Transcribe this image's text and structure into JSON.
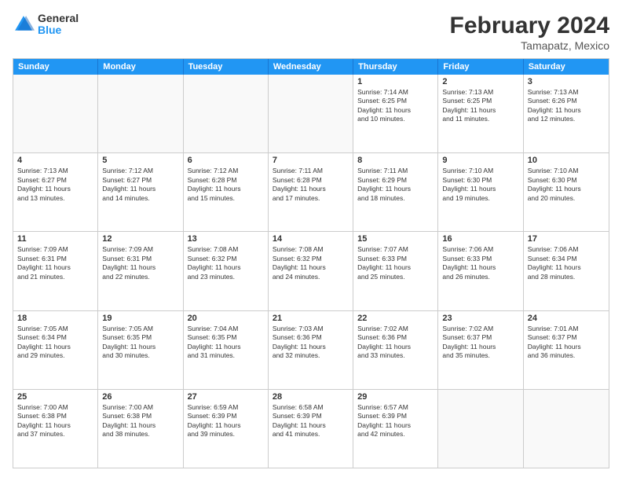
{
  "header": {
    "logo_general": "General",
    "logo_blue": "Blue",
    "month_title": "February 2024",
    "location": "Tamapatz, Mexico"
  },
  "days_of_week": [
    "Sunday",
    "Monday",
    "Tuesday",
    "Wednesday",
    "Thursday",
    "Friday",
    "Saturday"
  ],
  "rows": [
    [
      {
        "day": "",
        "text": ""
      },
      {
        "day": "",
        "text": ""
      },
      {
        "day": "",
        "text": ""
      },
      {
        "day": "",
        "text": ""
      },
      {
        "day": "1",
        "text": "Sunrise: 7:14 AM\nSunset: 6:25 PM\nDaylight: 11 hours\nand 10 minutes."
      },
      {
        "day": "2",
        "text": "Sunrise: 7:13 AM\nSunset: 6:25 PM\nDaylight: 11 hours\nand 11 minutes."
      },
      {
        "day": "3",
        "text": "Sunrise: 7:13 AM\nSunset: 6:26 PM\nDaylight: 11 hours\nand 12 minutes."
      }
    ],
    [
      {
        "day": "4",
        "text": "Sunrise: 7:13 AM\nSunset: 6:27 PM\nDaylight: 11 hours\nand 13 minutes."
      },
      {
        "day": "5",
        "text": "Sunrise: 7:12 AM\nSunset: 6:27 PM\nDaylight: 11 hours\nand 14 minutes."
      },
      {
        "day": "6",
        "text": "Sunrise: 7:12 AM\nSunset: 6:28 PM\nDaylight: 11 hours\nand 15 minutes."
      },
      {
        "day": "7",
        "text": "Sunrise: 7:11 AM\nSunset: 6:28 PM\nDaylight: 11 hours\nand 17 minutes."
      },
      {
        "day": "8",
        "text": "Sunrise: 7:11 AM\nSunset: 6:29 PM\nDaylight: 11 hours\nand 18 minutes."
      },
      {
        "day": "9",
        "text": "Sunrise: 7:10 AM\nSunset: 6:30 PM\nDaylight: 11 hours\nand 19 minutes."
      },
      {
        "day": "10",
        "text": "Sunrise: 7:10 AM\nSunset: 6:30 PM\nDaylight: 11 hours\nand 20 minutes."
      }
    ],
    [
      {
        "day": "11",
        "text": "Sunrise: 7:09 AM\nSunset: 6:31 PM\nDaylight: 11 hours\nand 21 minutes."
      },
      {
        "day": "12",
        "text": "Sunrise: 7:09 AM\nSunset: 6:31 PM\nDaylight: 11 hours\nand 22 minutes."
      },
      {
        "day": "13",
        "text": "Sunrise: 7:08 AM\nSunset: 6:32 PM\nDaylight: 11 hours\nand 23 minutes."
      },
      {
        "day": "14",
        "text": "Sunrise: 7:08 AM\nSunset: 6:32 PM\nDaylight: 11 hours\nand 24 minutes."
      },
      {
        "day": "15",
        "text": "Sunrise: 7:07 AM\nSunset: 6:33 PM\nDaylight: 11 hours\nand 25 minutes."
      },
      {
        "day": "16",
        "text": "Sunrise: 7:06 AM\nSunset: 6:33 PM\nDaylight: 11 hours\nand 26 minutes."
      },
      {
        "day": "17",
        "text": "Sunrise: 7:06 AM\nSunset: 6:34 PM\nDaylight: 11 hours\nand 28 minutes."
      }
    ],
    [
      {
        "day": "18",
        "text": "Sunrise: 7:05 AM\nSunset: 6:34 PM\nDaylight: 11 hours\nand 29 minutes."
      },
      {
        "day": "19",
        "text": "Sunrise: 7:05 AM\nSunset: 6:35 PM\nDaylight: 11 hours\nand 30 minutes."
      },
      {
        "day": "20",
        "text": "Sunrise: 7:04 AM\nSunset: 6:35 PM\nDaylight: 11 hours\nand 31 minutes."
      },
      {
        "day": "21",
        "text": "Sunrise: 7:03 AM\nSunset: 6:36 PM\nDaylight: 11 hours\nand 32 minutes."
      },
      {
        "day": "22",
        "text": "Sunrise: 7:02 AM\nSunset: 6:36 PM\nDaylight: 11 hours\nand 33 minutes."
      },
      {
        "day": "23",
        "text": "Sunrise: 7:02 AM\nSunset: 6:37 PM\nDaylight: 11 hours\nand 35 minutes."
      },
      {
        "day": "24",
        "text": "Sunrise: 7:01 AM\nSunset: 6:37 PM\nDaylight: 11 hours\nand 36 minutes."
      }
    ],
    [
      {
        "day": "25",
        "text": "Sunrise: 7:00 AM\nSunset: 6:38 PM\nDaylight: 11 hours\nand 37 minutes."
      },
      {
        "day": "26",
        "text": "Sunrise: 7:00 AM\nSunset: 6:38 PM\nDaylight: 11 hours\nand 38 minutes."
      },
      {
        "day": "27",
        "text": "Sunrise: 6:59 AM\nSunset: 6:39 PM\nDaylight: 11 hours\nand 39 minutes."
      },
      {
        "day": "28",
        "text": "Sunrise: 6:58 AM\nSunset: 6:39 PM\nDaylight: 11 hours\nand 41 minutes."
      },
      {
        "day": "29",
        "text": "Sunrise: 6:57 AM\nSunset: 6:39 PM\nDaylight: 11 hours\nand 42 minutes."
      },
      {
        "day": "",
        "text": ""
      },
      {
        "day": "",
        "text": ""
      }
    ]
  ]
}
